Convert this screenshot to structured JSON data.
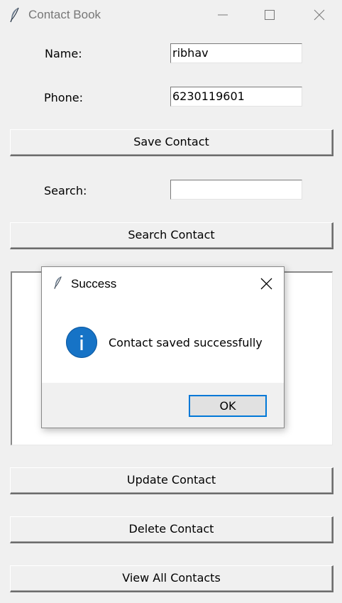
{
  "window": {
    "title": "Contact Book",
    "minimize_icon": "minimize-icon",
    "maximize_icon": "maximize-icon",
    "close_icon": "close-icon"
  },
  "form": {
    "name_label": "Name:",
    "name_value": "ribhav",
    "phone_label": "Phone:",
    "phone_value": "6230119601",
    "search_label": "Search:",
    "search_value": ""
  },
  "buttons": {
    "save": "Save Contact",
    "search": "Search Contact",
    "update": "Update Contact",
    "delete": "Delete Contact",
    "view_all": "View All Contacts"
  },
  "contacts_list": [],
  "dialog": {
    "title": "Success",
    "message": "Contact saved successfully",
    "ok_label": "OK",
    "icon": "info-icon",
    "accent_color": "#1673c6",
    "focus_color": "#0078d7"
  }
}
